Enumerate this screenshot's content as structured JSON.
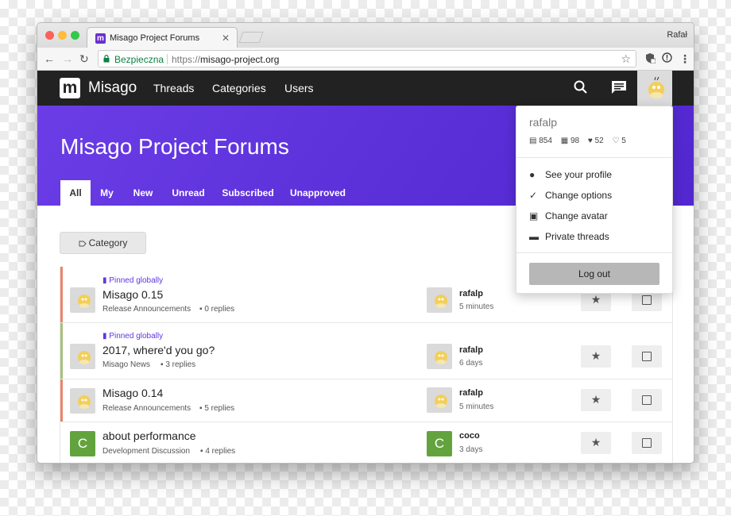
{
  "browser": {
    "tab_title": "Misago Project Forums",
    "favicon_letter": "m",
    "window_user": "Rafał",
    "secure_label": "Bezpieczna",
    "url_scheme": "https://",
    "url_host": "misago-project.org"
  },
  "site": {
    "logo_letter": "m",
    "brand": "Misago",
    "nav": [
      "Threads",
      "Categories",
      "Users"
    ],
    "accent_color": "#6236e1",
    "navbar_color": "#222222"
  },
  "hero": {
    "title": "Misago Project Forums",
    "tabs": [
      "All",
      "My",
      "New",
      "Unread",
      "Subscribed",
      "Unapproved"
    ],
    "active_tab": "All"
  },
  "filters": {
    "category_label": "Category"
  },
  "threads": [
    {
      "pinned_label": "Pinned globally",
      "title": "Misago 0.15",
      "category": "Release Announcements",
      "replies": "0 replies",
      "last_poster": "rafalp",
      "last_time": "5 minutes",
      "stripe_color": "#e8866a"
    },
    {
      "pinned_label": "Pinned globally",
      "title": "2017, where'd you go?",
      "category": "Misago News",
      "replies": "3 replies",
      "last_poster": "rafalp",
      "last_time": "6 days",
      "stripe_color": "#a9c07a"
    },
    {
      "pinned_label": "",
      "title": "Misago 0.14",
      "category": "Release Announcements",
      "replies": "5 replies",
      "last_poster": "rafalp",
      "last_time": "5 minutes",
      "stripe_color": "#e8866a"
    },
    {
      "pinned_label": "",
      "title": "about performance",
      "category": "Development Discussion",
      "replies": "4 replies",
      "last_poster": "coco",
      "last_time": "3 days",
      "avatar_letter": "C",
      "stripe_color": ""
    }
  ],
  "user_menu": {
    "username": "rafalp",
    "stats": {
      "posts": "854",
      "threads": "98",
      "likes": "52",
      "followers": "5"
    },
    "items": [
      "See your profile",
      "Change options",
      "Change avatar",
      "Private threads"
    ],
    "logout": "Log out"
  }
}
